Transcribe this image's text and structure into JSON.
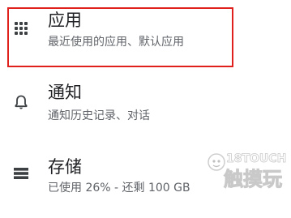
{
  "settings": {
    "items": [
      {
        "title": "应用",
        "subtitle": "最近使用的应用、默认应用",
        "icon": "apps-grid-icon",
        "highlighted": true
      },
      {
        "title": "通知",
        "subtitle": "通知历史记录、对话",
        "icon": "bell-icon"
      },
      {
        "title": "存储",
        "subtitle": "已使用 26% - 还剩 100 GB",
        "icon": "storage-icon"
      }
    ]
  },
  "watermark": {
    "brand": "18TOUCH",
    "text": "触摸玩"
  },
  "colors": {
    "highlight_border": "#e0201c",
    "title": "#202124",
    "subtitle": "#5f6368",
    "icon": "#3c4043"
  }
}
